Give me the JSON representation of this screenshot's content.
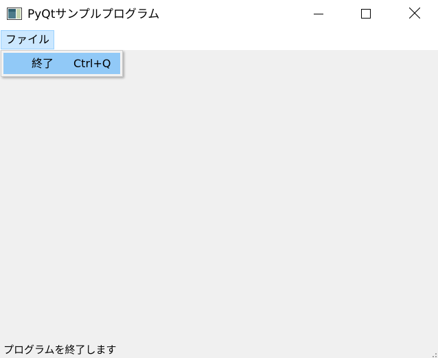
{
  "window": {
    "title": "PyQtサンプルプログラム",
    "controls": {
      "minimize_icon": "minimize-icon",
      "maximize_icon": "maximize-icon",
      "close_icon": "close-icon"
    }
  },
  "menubar": {
    "menus": [
      {
        "label": "ファイル",
        "open": true
      }
    ]
  },
  "dropdown": {
    "items": [
      {
        "label": "終了",
        "shortcut": "Ctrl+Q",
        "highlighted": true
      }
    ]
  },
  "statusbar": {
    "message": "プログラムを終了します"
  },
  "colors": {
    "titlebar_bg": "#ffffff",
    "client_bg": "#f0f0f0",
    "menu_open_bg": "#cce8ff",
    "menu_open_border": "#99d1ff",
    "menu_item_highlight": "#91c9f7",
    "dropdown_bg": "#f2f2f2"
  }
}
